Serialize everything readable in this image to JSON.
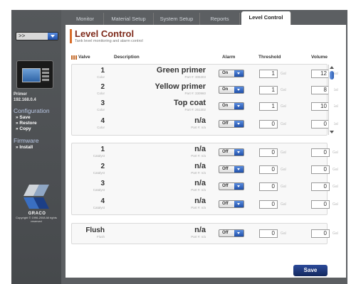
{
  "tabs": [
    "Monitor",
    "Material Setup",
    "System Setup",
    "Reports",
    "Level Control"
  ],
  "sidebar": {
    "select_value": ">>",
    "device_label": "Primer",
    "device_ip": "192.168.0.4",
    "configuration_heading": "Configuration",
    "configuration_links": [
      "» Save",
      "» Restore",
      "» Copy"
    ],
    "firmware_heading": "Firmware",
    "firmware_links": [
      "» Install"
    ],
    "logo_text": "GRACO",
    "copyright": "Copyright © 1996-2008 All rights reserved"
  },
  "page": {
    "title": "Level Control",
    "subtitle": "Tank level monitoring and alarm control"
  },
  "columns": {
    "valve": "Valve",
    "description": "Description",
    "alarm": "Alarm",
    "threshold": "Threshold",
    "volume": "Volume"
  },
  "groups": [
    {
      "rows": [
        {
          "valve": "1",
          "sub": "Color",
          "description": "Green primer",
          "part": "Part #: 305303",
          "alarm": "On",
          "threshold": "1",
          "volume": "12",
          "unit": "Gal"
        },
        {
          "valve": "2",
          "sub": "Color",
          "description": "Yellow primer",
          "part": "Part #: 330960",
          "alarm": "On",
          "threshold": "1",
          "volume": "8",
          "unit": "Gal"
        },
        {
          "valve": "3",
          "sub": "Color",
          "description": "Top coat",
          "part": "Part #: 261302",
          "alarm": "On",
          "threshold": "1",
          "volume": "10",
          "unit": "Gal"
        },
        {
          "valve": "4",
          "sub": "Color",
          "description": "n/a",
          "part": "Part #: n/a",
          "alarm": "Off",
          "threshold": "0",
          "volume": "0",
          "unit": "Gal"
        }
      ]
    },
    {
      "rows": [
        {
          "valve": "1",
          "sub": "Catalyst",
          "description": "n/a",
          "part": "Part #: n/a",
          "alarm": "Off",
          "threshold": "0",
          "volume": "0",
          "unit": "Gal"
        },
        {
          "valve": "2",
          "sub": "Catalyst",
          "description": "n/a",
          "part": "Part #: n/a",
          "alarm": "Off",
          "threshold": "0",
          "volume": "0",
          "unit": "Gal"
        },
        {
          "valve": "3",
          "sub": "Catalyst",
          "description": "n/a",
          "part": "Part #: n/a",
          "alarm": "Off",
          "threshold": "0",
          "volume": "0",
          "unit": "Gal"
        },
        {
          "valve": "4",
          "sub": "Catalyst",
          "description": "n/a",
          "part": "Part #: n/a",
          "alarm": "Off",
          "threshold": "0",
          "volume": "0",
          "unit": "Gal"
        }
      ]
    },
    {
      "rows": [
        {
          "valve": "Flush",
          "sub": "Flush",
          "description": "n/a",
          "part": "Part #: n/a",
          "alarm": "Off",
          "threshold": "0",
          "volume": "0",
          "unit": "Gal"
        }
      ]
    }
  ],
  "save_label": "Save",
  "colors": {
    "accent": "#7e2a1a",
    "title_bar": "#d86d2a",
    "button": "#1f3c86",
    "chrome": "#5c5f62"
  }
}
